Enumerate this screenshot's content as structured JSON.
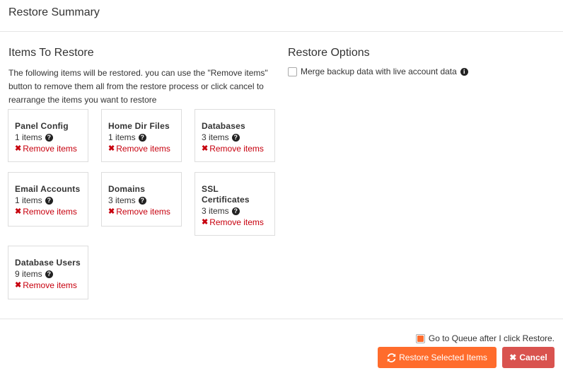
{
  "header": {
    "title": "Restore Summary"
  },
  "items_section": {
    "heading": "Items To Restore",
    "description": "The following items will be restored. you can use the \"Remove items\" button to remove them all from the restore process or click cancel to rearrange the items you want to restore",
    "remove_label": "Remove items",
    "cards": [
      {
        "title": "Panel Config",
        "count": "1 items"
      },
      {
        "title": "Home Dir Files",
        "count": "1 items"
      },
      {
        "title": "Databases",
        "count": "3 items"
      },
      {
        "title": "Email Accounts",
        "count": "1 items"
      },
      {
        "title": "Domains",
        "count": "3 items"
      },
      {
        "title": "SSL Certificates",
        "count": "3 items"
      },
      {
        "title": "Database Users",
        "count": "9 items"
      }
    ]
  },
  "options_section": {
    "heading": "Restore Options",
    "merge_label": "Merge backup data with live account data",
    "merge_checked": false
  },
  "footer": {
    "queue_label": "Go to Queue after I click Restore.",
    "queue_checked": true,
    "restore_button": "Restore Selected Items",
    "cancel_button": "Cancel"
  },
  "colors": {
    "primary": "#ff6c2c",
    "danger": "#d9534f",
    "remove_text": "#c7000e"
  }
}
